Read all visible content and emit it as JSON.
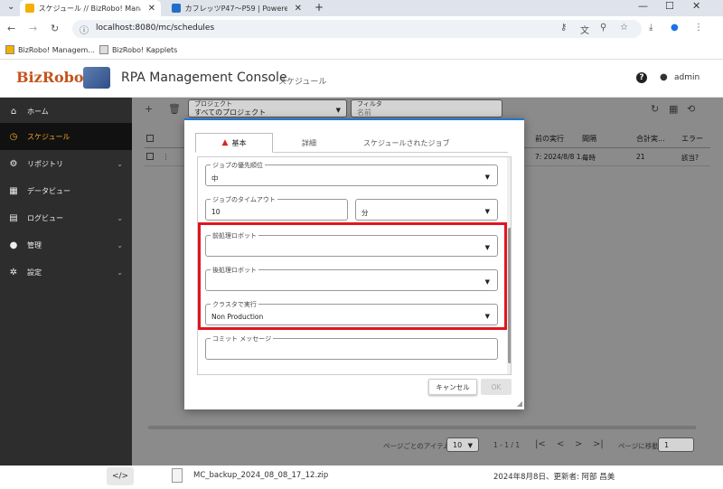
{
  "browser": {
    "tabs": [
      {
        "title": "スケジュール // BizRobo! Manage",
        "close": "✕"
      },
      {
        "title": "カフレッツP47～P59 | Powered by",
        "close": "✕"
      }
    ],
    "new_tab": "+",
    "window_controls": [
      "—",
      "☐",
      "✕"
    ],
    "url": "localhost:8080/mc/schedules",
    "bookmarks": [
      "BizRobo! Managem...",
      "BizRobo! Kapplets"
    ]
  },
  "app": {
    "logo": "BizRobo!",
    "title": "RPA Management Console",
    "subtitle": "スケジュール",
    "help": "?",
    "user": "admin"
  },
  "sidebar": {
    "items": [
      {
        "label": "ホーム",
        "icon": "home-icon",
        "glyph": "⌂"
      },
      {
        "label": "スケジュール",
        "icon": "clock-icon",
        "glyph": "◷"
      },
      {
        "label": "リポジトリ",
        "icon": "cogs-icon",
        "glyph": "⚙",
        "chev": "⌄"
      },
      {
        "label": "データビュー",
        "icon": "dataview-icon",
        "glyph": "▦"
      },
      {
        "label": "ログビュー",
        "icon": "log-icon",
        "glyph": "▤",
        "chev": "⌄"
      },
      {
        "label": "管理",
        "icon": "person-icon",
        "glyph": "●",
        "chev": "⌄"
      },
      {
        "label": "設定",
        "icon": "gear-icon",
        "glyph": "✲",
        "chev": "⌄"
      }
    ]
  },
  "toolbar": {
    "project_label": "プロジェクト",
    "project_value": "すべてのプロジェクト",
    "filter_label": "フィルタ",
    "filter_placeholder": "名前"
  },
  "table": {
    "headers": [
      "前の実行",
      "間隔",
      "合計実...",
      "エラー"
    ],
    "row": {
      "prev_run": "7: 2024/8/8 1...",
      "interval": "毎時",
      "total": "21",
      "error": "該当?"
    }
  },
  "pager": {
    "items_per_page_label": "ページごとのアイテム",
    "items_per_page": "10",
    "range": "1 - 1 / 1",
    "goto_label": "ページに移動",
    "goto_value": "1"
  },
  "dialog": {
    "tabs": [
      "基本",
      "詳細",
      "スケジュールされたジョブ"
    ],
    "fields": {
      "priority_label": "ジョブの優先順位",
      "priority_value": "中",
      "timeout_label": "ジョブのタイムアウト",
      "timeout_value": "10",
      "timeout_unit": "分",
      "pre_robot_label": "前処理ロボット",
      "post_robot_label": "後処理ロボット",
      "cluster_label": "クラスタで実行",
      "cluster_value": "Non Production",
      "commit_label": "コミット メッセージ"
    },
    "cancel": "キャンセル",
    "ok": "OK"
  },
  "download": {
    "filename": "MC_backup_2024_08_08_17_12.zip",
    "meta": "2024年8月8日、更新者: 阿部 昌美"
  },
  "colors": {
    "accent": "#1f78d1",
    "highlight": "#e0161d",
    "sidebar_active": "#f5a623",
    "logo": "#c5531a"
  }
}
